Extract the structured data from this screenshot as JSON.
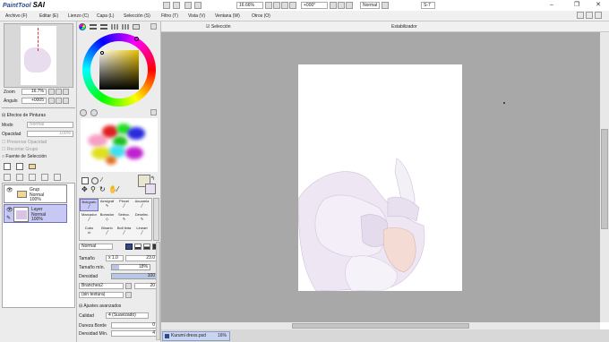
{
  "app": {
    "logo_text": "PaintTool",
    "logo_sai": "SAI"
  },
  "window": {
    "minimize": "–",
    "restore": "❐",
    "close": "✕"
  },
  "menu": [
    "Archivo (F)",
    "Editar (E)",
    "Lienzo (C)",
    "Capa (L)",
    "Selección (S)",
    "Filtro (T)",
    "Vista (V)",
    "Ventana (W)",
    "Otros (O)"
  ],
  "canvas_toolbar": {
    "selection_label": "Selección",
    "zoom": "16.66%",
    "rotation": "+000°",
    "blend_mode": "Normal",
    "stabilizer_label": "Estabilizador",
    "stabilizer_value": "S-7"
  },
  "navigator": {
    "zoom_label": "Zoom",
    "zoom_value": "16.7%",
    "angle_label": "Ángulo",
    "angle_value": "+0005"
  },
  "layer_panel": {
    "effects_label": "Efectos de Pinturas",
    "mode_label": "Modo",
    "mode_value": "Normal",
    "opacity_label": "Opacidad",
    "opacity_value": "100%",
    "preserve_opacity": "Preservar Opacidad",
    "clip_group": "Recortar Grupo",
    "selection_source": "Fuente de Selección",
    "layers": [
      {
        "name": "Grup",
        "mode": "Normal",
        "opacity": "100%"
      },
      {
        "name": "Layer",
        "mode": "Normal",
        "opacity": "100%"
      }
    ]
  },
  "brushes": [
    {
      "name": "Bolígrafo"
    },
    {
      "name": "Aerógraf"
    },
    {
      "name": "Pincel"
    },
    {
      "name": "Acuarela"
    },
    {
      "name": "Marcador"
    },
    {
      "name": "Borrador"
    },
    {
      "name": "Selecc."
    },
    {
      "name": "Deselec."
    },
    {
      "name": "Cubo"
    },
    {
      "name": "Binario"
    },
    {
      "name": "Boli tinta"
    },
    {
      "name": "Lineart"
    }
  ],
  "brush_settings": {
    "blend_mode": "Normal",
    "size_label": "Tamaño",
    "size_mult": "x 1.0",
    "size_value": "23.0",
    "min_size_label": "Tamaño mín.",
    "min_size_value": "18%",
    "min_size_fraction": 0.18,
    "density_label": "Densidad",
    "density_value": "100",
    "density_fraction": 1.0,
    "texture1": "Branches2",
    "texture1_value": "20",
    "texture2": "(sin textura)",
    "advanced_label": "Ajustes avanzados",
    "quality_label": "Calidad",
    "quality_value": "4 (Suavizado)",
    "edge_hardness_label": "Dureza Borde",
    "edge_hardness_value": "0",
    "min_density_label": "Densidad Mín.",
    "min_density_value": "4"
  },
  "document_tab": {
    "name": "Kurumi dress.psd",
    "zoom": "16%"
  },
  "colors": {
    "accent": "#2a4c8c",
    "canvas_bg": "#a8a8a8",
    "panel_bg": "#ececec",
    "primary_swatch": "#e8e6d0"
  }
}
